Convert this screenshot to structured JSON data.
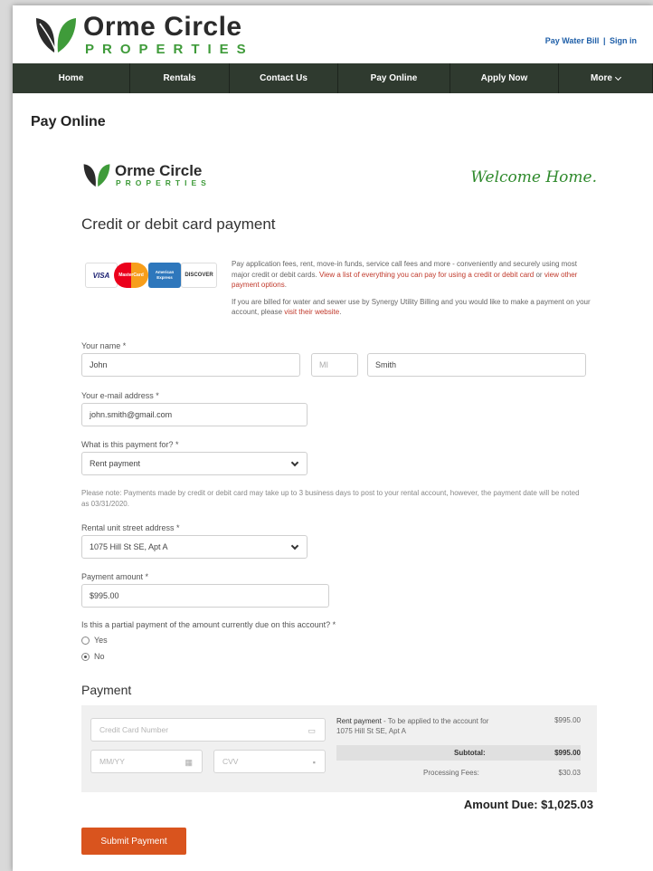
{
  "header": {
    "logo_name": "Orme Circle",
    "logo_sub": "PROPERTIES",
    "links": [
      "Pay Water Bill",
      "Sign in"
    ],
    "link_separator": "|"
  },
  "nav": {
    "items": [
      "Home",
      "Rentals",
      "Contact Us",
      "Pay Online",
      "Apply Now",
      "More"
    ]
  },
  "page_title": "Pay Online",
  "form_header": {
    "logo_name": "Orme Circle",
    "logo_sub": "PROPERTIES",
    "welcome": "Welcome Home.",
    "title": "Credit or debit card payment"
  },
  "card_logos": [
    "VISA",
    "MasterCard",
    "American Express",
    "DISCOVER"
  ],
  "intro": {
    "p1_text": "Pay application fees, rent, move-in funds, service call fees and more - conveniently and securely using most major credit or debit cards.",
    "p1_link1": "View a list of everything you can pay for using a credit or debit card",
    "p1_mid": "or",
    "p1_link2": "view other payment options",
    "p1_end": ".",
    "p2_text": "If you are billed for water and sewer use by Synergy Utility Billing and you would like to make a payment on your account, please",
    "p2_link": "visit their website",
    "p2_end": "."
  },
  "form": {
    "name_label": "Your name *",
    "first_name": "John",
    "middle_initial_placeholder": "MI",
    "last_name": "Smith",
    "email_label": "Your e-mail address *",
    "email": "john.smith@gmail.com",
    "purpose_label": "What is this payment for? *",
    "purpose_value": "Rent payment",
    "note": "Please note: Payments made by credit or debit card may take up to 3 business days to post to your rental account, however, the payment date will be noted as 03/31/2020.",
    "address_label": "Rental unit street address *",
    "address_value": "1075 Hill St SE, Apt A",
    "amount_label": "Payment amount *",
    "amount_value": "$995.00",
    "partial_label": "Is this a partial payment of the amount currently due on this account? *",
    "partial_options": [
      "Yes",
      "No"
    ],
    "partial_selected": "No"
  },
  "payment": {
    "title": "Payment",
    "card_number_placeholder": "Credit Card Number",
    "expiry_placeholder": "MM/YY",
    "cvv_placeholder": "CVV",
    "line_item_title": "Rent payment",
    "line_item_desc": " - To be applied to the account for 1075 Hill St SE, Apt A",
    "line_item_amount": "$995.00",
    "subtotal_label": "Subtotal:",
    "subtotal_value": "$995.00",
    "fees_label": "Processing Fees:",
    "fees_value": "$30.03",
    "amount_due_label": "Amount Due:",
    "amount_due_value": "$1,025.03",
    "submit_label": "Submit Payment"
  },
  "colors": {
    "brand_green": "#3f9b3a",
    "nav_bg": "#2f3a2f",
    "link_red": "#c0392b",
    "submit_orange": "#d9541e"
  }
}
